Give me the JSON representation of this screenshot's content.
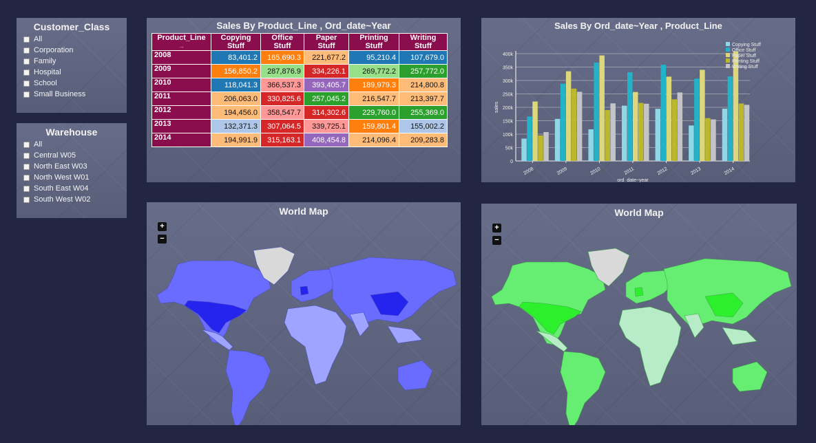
{
  "customer_class": {
    "title": "Customer_Class",
    "options": [
      "All",
      "Corporation",
      "Family",
      "Hospital",
      "School",
      "Small Business"
    ]
  },
  "warehouse": {
    "title": "Warehouse",
    "options": [
      "All",
      "Central W05",
      "North East W03",
      "North West W01",
      "South East W04",
      "South West W02"
    ]
  },
  "pivot": {
    "title": "Sales By Product_Line , Ord_date~Year",
    "corner_label": "Product_Line",
    "columns": [
      "Copying Stuff",
      "Office Stuff",
      "Paper Stuff",
      "Printing Stuff",
      "Writing Stuff"
    ],
    "rows": [
      {
        "year": "2008",
        "cells": [
          {
            "v": "83,401.2",
            "c": "#1f77b4"
          },
          {
            "v": "165,690.3",
            "c": "#ff7f0e"
          },
          {
            "v": "221,677.2",
            "c": "#ffbb78"
          },
          {
            "v": "95,210.4",
            "c": "#1f77b4"
          },
          {
            "v": "107,679.0",
            "c": "#1f77b4"
          }
        ]
      },
      {
        "year": "2009",
        "cells": [
          {
            "v": "156,850.2",
            "c": "#ff7f0e"
          },
          {
            "v": "287,876.9",
            "c": "#98df8a"
          },
          {
            "v": "334,226.1",
            "c": "#d62728"
          },
          {
            "v": "269,772.2",
            "c": "#98df8a"
          },
          {
            "v": "257,772.0",
            "c": "#2ca02c"
          }
        ]
      },
      {
        "year": "2010",
        "cells": [
          {
            "v": "118,041.3",
            "c": "#1f77b4"
          },
          {
            "v": "366,537.3",
            "c": "#ff9896"
          },
          {
            "v": "393,405.7",
            "c": "#9467bd"
          },
          {
            "v": "189,979.3",
            "c": "#ff7f0e"
          },
          {
            "v": "214,800.8",
            "c": "#ffbb78"
          }
        ]
      },
      {
        "year": "2011",
        "cells": [
          {
            "v": "206,063.0",
            "c": "#ffbb78"
          },
          {
            "v": "330,825.6",
            "c": "#d62728"
          },
          {
            "v": "257,045.2",
            "c": "#2ca02c"
          },
          {
            "v": "216,547.7",
            "c": "#ffbb78"
          },
          {
            "v": "213,397.7",
            "c": "#ffbb78"
          }
        ]
      },
      {
        "year": "2012",
        "cells": [
          {
            "v": "194,456.0",
            "c": "#ffbb78"
          },
          {
            "v": "358,547.7",
            "c": "#ff9896"
          },
          {
            "v": "314,302.6",
            "c": "#d62728"
          },
          {
            "v": "229,760.0",
            "c": "#2ca02c"
          },
          {
            "v": "255,369.0",
            "c": "#2ca02c"
          }
        ]
      },
      {
        "year": "2013",
        "cells": [
          {
            "v": "132,371.3",
            "c": "#aec7e8"
          },
          {
            "v": "307,064.5",
            "c": "#d62728"
          },
          {
            "v": "339,725.1",
            "c": "#ff9896"
          },
          {
            "v": "159,801.4",
            "c": "#ff7f0e"
          },
          {
            "v": "155,002.2",
            "c": "#aec7e8"
          }
        ]
      },
      {
        "year": "2014",
        "cells": [
          {
            "v": "194,991.9",
            "c": "#ffbb78"
          },
          {
            "v": "315,163.1",
            "c": "#d62728"
          },
          {
            "v": "408,454.8",
            "c": "#9467bd"
          },
          {
            "v": "214,096.4",
            "c": "#ffbb78"
          },
          {
            "v": "209,283.8",
            "c": "#ffbb78"
          }
        ]
      }
    ]
  },
  "chart_data": {
    "type": "bar",
    "title": "Sales By Ord_date~Year , Product_Line",
    "xlabel": "ord_date~year",
    "ylabel": "sales",
    "categories": [
      "2008",
      "2009",
      "2010",
      "2011",
      "2012",
      "2013",
      "2014"
    ],
    "yticks": [
      "0",
      "50k",
      "100k",
      "150k",
      "200k",
      "250k",
      "300k",
      "350k",
      "400k"
    ],
    "ylim": [
      0,
      400000
    ],
    "legend_position": "top-right",
    "series": [
      {
        "name": "Copying Stuff",
        "color": "#8fd6e6",
        "values": [
          83401.2,
          156850.2,
          118041.3,
          206063.0,
          194456.0,
          132371.3,
          194991.9
        ]
      },
      {
        "name": "Office Stuff",
        "color": "#22b3c9",
        "values": [
          165690.3,
          287876.9,
          366537.3,
          330825.6,
          358547.7,
          307064.5,
          315163.1
        ]
      },
      {
        "name": "Paper Stuff",
        "color": "#dcd77a",
        "values": [
          221677.2,
          334226.1,
          393405.7,
          257045.2,
          314302.6,
          339725.1,
          408454.8
        ]
      },
      {
        "name": "Printing Stuff",
        "color": "#bcb82c",
        "values": [
          95210.4,
          269772.2,
          189979.3,
          216547.7,
          229760.0,
          159801.4,
          214096.4
        ]
      },
      {
        "name": "Writing Stuff",
        "color": "#c4c4c8",
        "values": [
          107679.0,
          257772.0,
          214800.8,
          213397.7,
          255369.0,
          155002.2,
          209283.8
        ]
      }
    ]
  },
  "map_left": {
    "title": "World Map",
    "zoom_in": "+",
    "zoom_out": "−"
  },
  "map_right": {
    "title": "World Map",
    "zoom_in": "+",
    "zoom_out": "−"
  }
}
